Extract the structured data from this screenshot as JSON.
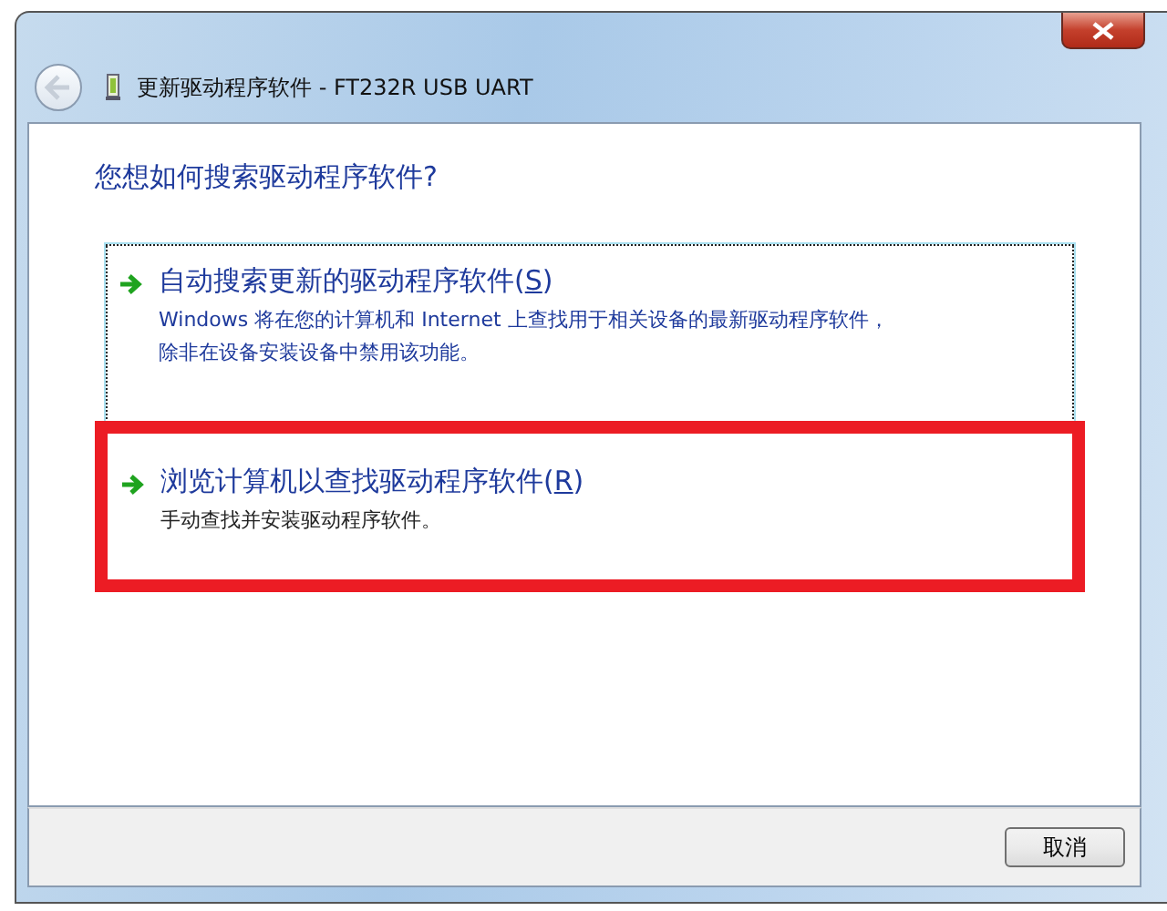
{
  "window": {
    "title": "更新驱动程序软件 - FT232R USB UART"
  },
  "heading": "您想如何搜索驱动程序软件?",
  "options": [
    {
      "label": "自动搜索更新的驱动程序软件(",
      "accesskey": "S",
      "label_end": ")",
      "description": "Windows 将在您的计算机和 Internet 上查找用于相关设备的最新驱动程序软件，除非在设备安装设备中禁用该功能。",
      "focused": true,
      "highlighted": false
    },
    {
      "label": "浏览计算机以查找驱动程序软件(",
      "accesskey": "R",
      "label_end": ")",
      "description": "手动查找并安装驱动程序软件。",
      "focused": false,
      "highlighted": true
    }
  ],
  "buttons": [
    {
      "label": "取消"
    }
  ]
}
